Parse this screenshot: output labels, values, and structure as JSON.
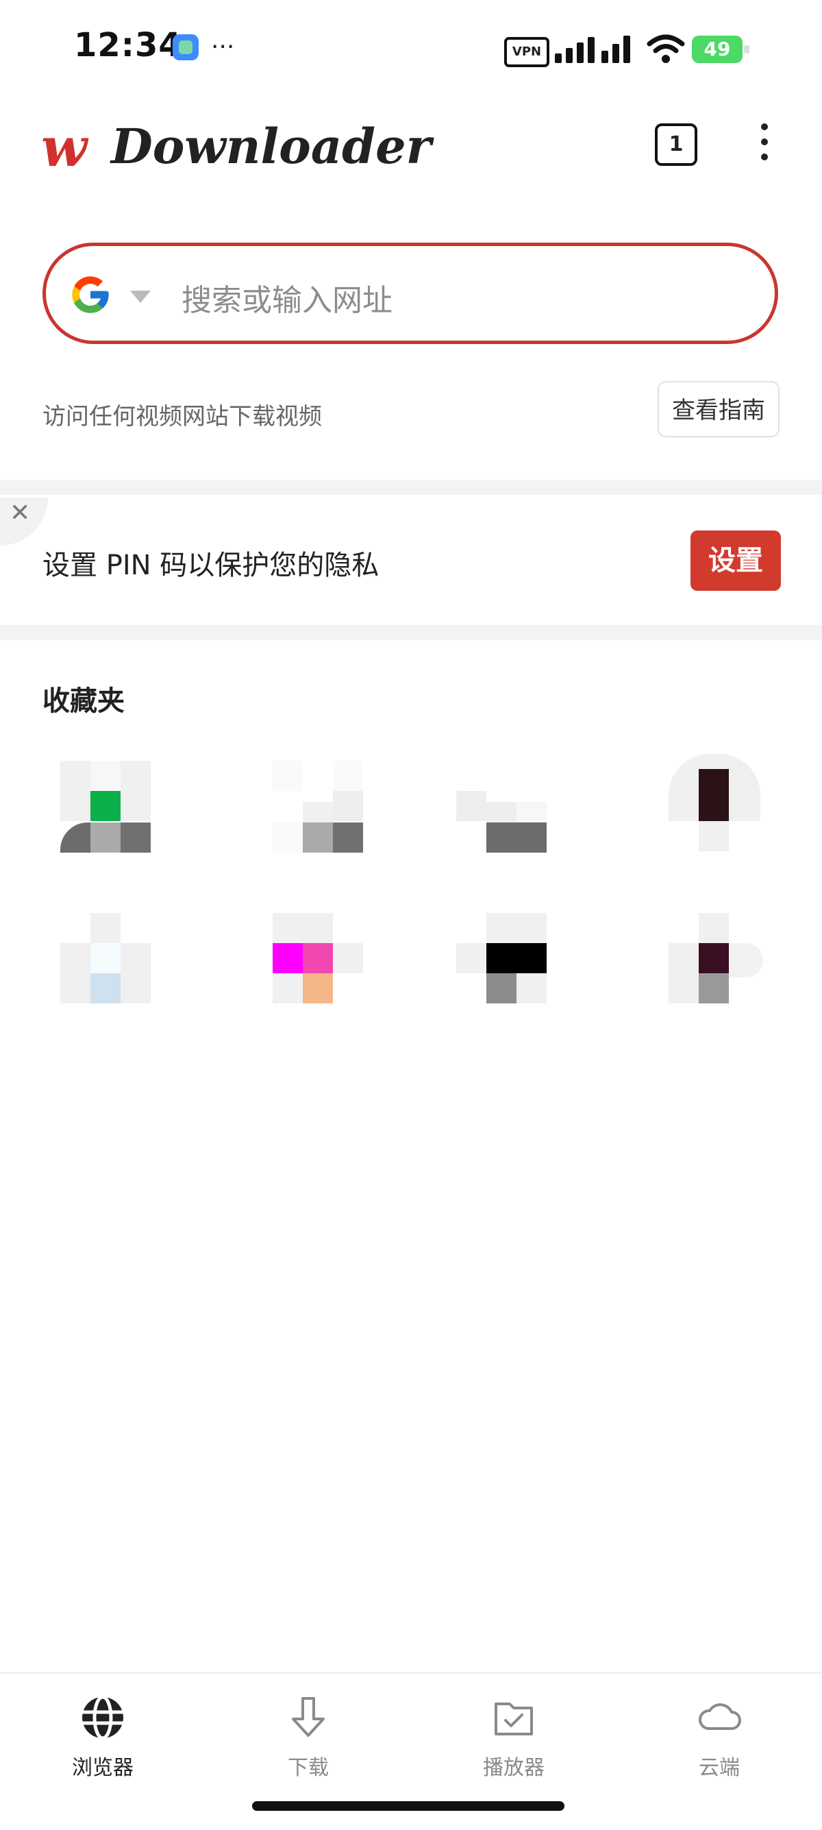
{
  "status_bar": {
    "time": "12:34",
    "dots": "···",
    "vpn": "VPN",
    "battery": "49"
  },
  "header": {
    "logo_w": "w",
    "logo_text": "Downloader",
    "tab_count": "1"
  },
  "search": {
    "placeholder": "搜索或输入网址",
    "engine_icon": "google-icon"
  },
  "hint": {
    "text": "访问任何视频网站下载视频",
    "guide_label": "查看指南"
  },
  "pin_banner": {
    "text": "设置 PIN 码以保护您的隐私",
    "button_label": "设置",
    "close": "✕"
  },
  "favorites": {
    "title": "收藏夹"
  },
  "bottom_nav": {
    "items": [
      {
        "label": "浏览器",
        "icon": "globe-icon",
        "active": true
      },
      {
        "label": "下载",
        "icon": "download-arrow-icon",
        "active": false
      },
      {
        "label": "播放器",
        "icon": "folder-check-icon",
        "active": false
      },
      {
        "label": "云端",
        "icon": "cloud-icon",
        "active": false
      }
    ]
  },
  "colors": {
    "accent": "#d23a2e",
    "search_border": "#c9362e"
  }
}
